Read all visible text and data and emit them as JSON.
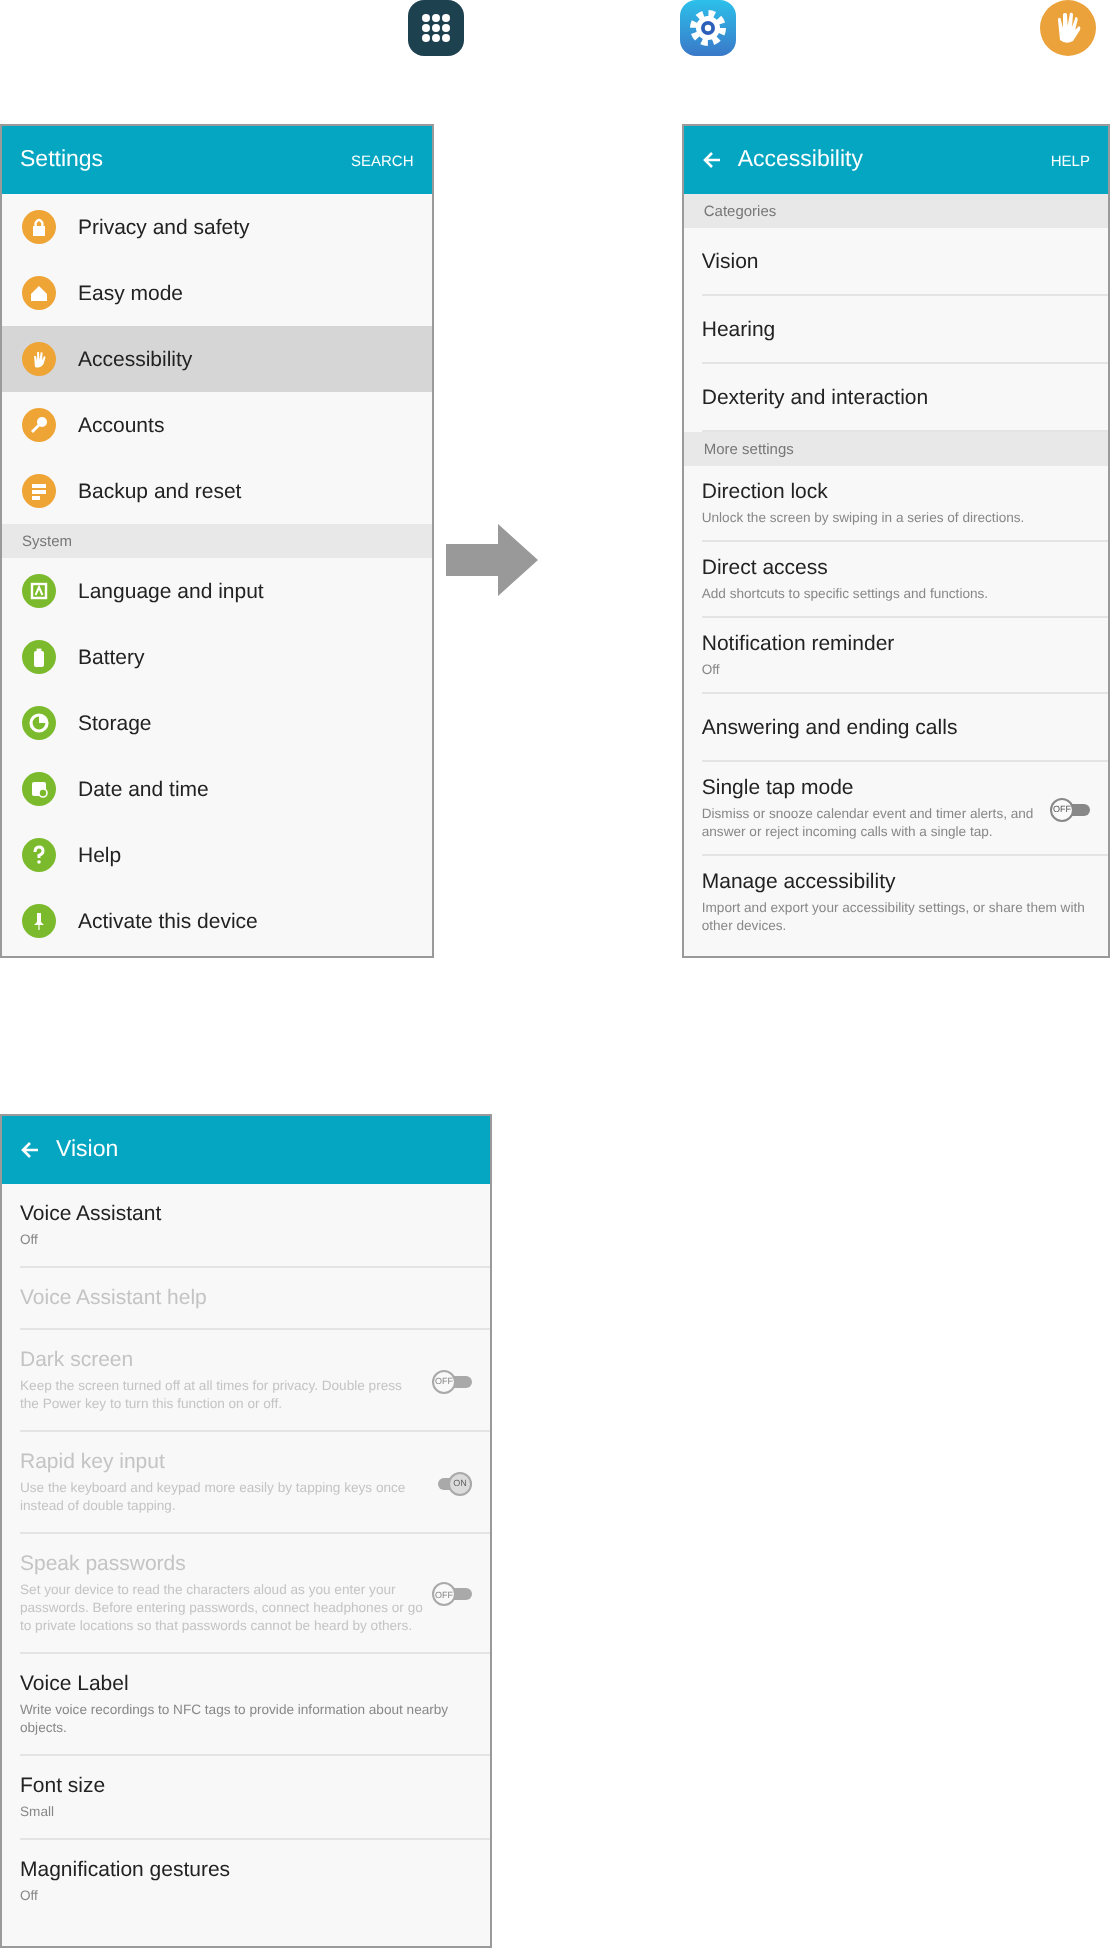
{
  "settings": {
    "title": "Settings",
    "action": "SEARCH",
    "sections": [
      {
        "items": [
          {
            "label": "Privacy and safety",
            "color": "#efa436",
            "selected": false
          },
          {
            "label": "Easy mode",
            "color": "#efa436",
            "selected": false
          },
          {
            "label": "Accessibility",
            "color": "#efa436",
            "selected": true
          },
          {
            "label": "Accounts",
            "color": "#efa436",
            "selected": false
          },
          {
            "label": "Backup and reset",
            "color": "#efa436",
            "selected": false
          }
        ]
      },
      {
        "header": "System",
        "items": [
          {
            "label": "Language and input",
            "color": "#7cba2d",
            "selected": false
          },
          {
            "label": "Battery",
            "color": "#7cba2d",
            "selected": false
          },
          {
            "label": "Storage",
            "color": "#7cba2d",
            "selected": false
          },
          {
            "label": "Date and time",
            "color": "#7cba2d",
            "selected": false
          },
          {
            "label": "Help",
            "color": "#7cba2d",
            "selected": false
          },
          {
            "label": "Activate this device",
            "color": "#7cba2d",
            "selected": false
          }
        ]
      }
    ]
  },
  "accessibility": {
    "title": "Accessibility",
    "action": "HELP",
    "sections": [
      {
        "header": "Categories",
        "items": [
          {
            "title": "Vision"
          },
          {
            "title": "Hearing"
          },
          {
            "title": "Dexterity and interaction"
          }
        ]
      },
      {
        "header": "More settings",
        "items": [
          {
            "title": "Direction lock",
            "subtitle": "Unlock the screen by swiping in a series of directions."
          },
          {
            "title": "Direct access",
            "subtitle": "Add shortcuts to specific settings and functions."
          },
          {
            "title": "Notification reminder",
            "subtitle": "Off"
          },
          {
            "title": "Answering and ending calls"
          },
          {
            "title": "Single tap mode",
            "subtitle": "Dismiss or snooze calendar event and timer alerts, and answer or reject incoming calls with a single tap.",
            "toggle": {
              "on": false,
              "label": "OFF"
            }
          },
          {
            "title": "Manage accessibility",
            "subtitle": "Import and export your accessibility settings, or share them with other devices."
          }
        ]
      }
    ]
  },
  "vision": {
    "title": "Vision",
    "items": [
      {
        "title": "Voice Assistant",
        "subtitle": "Off",
        "disabled": false
      },
      {
        "title": "Voice Assistant help",
        "disabled": true
      },
      {
        "title": "Dark screen",
        "subtitle": "Keep the screen turned off at all times for privacy. Double press the Power key to turn this function on or off.",
        "disabled": true,
        "toggle": {
          "on": false,
          "label": "OFF"
        }
      },
      {
        "title": "Rapid key input",
        "subtitle": "Use the keyboard and keypad more easily by tapping keys once instead of double tapping.",
        "disabled": true,
        "toggle": {
          "on": true,
          "label": "ON"
        }
      },
      {
        "title": "Speak passwords",
        "subtitle": "Set your device to read the characters aloud as you enter your passwords. Before entering passwords, connect headphones or go to private locations so that passwords cannot be heard by others.",
        "disabled": true,
        "toggle": {
          "on": false,
          "label": "OFF"
        }
      },
      {
        "title": "Voice Label",
        "subtitle": "Write voice recordings to NFC tags to provide information about nearby objects.",
        "disabled": false
      },
      {
        "title": "Font size",
        "subtitle": "Small",
        "disabled": false
      },
      {
        "title": "Magnification gestures",
        "subtitle": "Off",
        "disabled": false
      }
    ]
  }
}
